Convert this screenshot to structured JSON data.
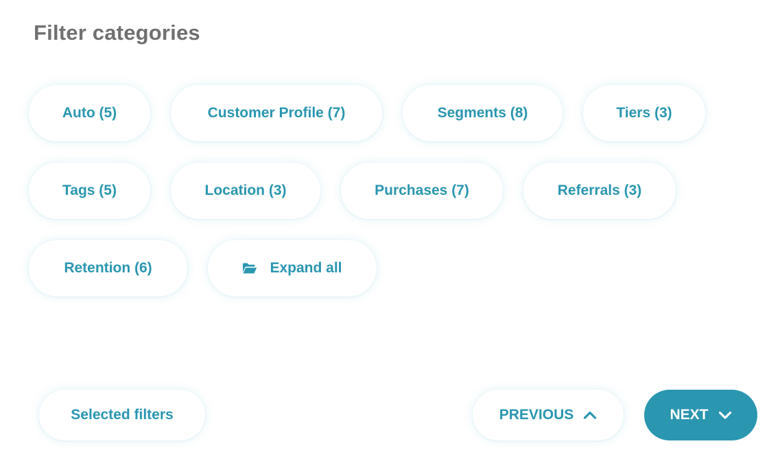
{
  "header": {
    "title": "Filter categories"
  },
  "chips": {
    "auto": "Auto (5)",
    "customer_profile": "Customer Profile (7)",
    "segments": "Segments (8)",
    "tiers": "Tiers (3)",
    "tags": "Tags (5)",
    "location": "Location (3)",
    "purchases": "Purchases (7)",
    "referrals": "Referrals (3)",
    "retention": "Retention (6)",
    "expand_all": "Expand all"
  },
  "footer": {
    "selected_filters": "Selected filters",
    "previous": "PREVIOUS",
    "next": "NEXT"
  },
  "icons": {
    "expand_all": "folder-open-icon",
    "previous": "chevron-up-icon",
    "next": "chevron-down-icon"
  },
  "colors": {
    "accent": "#2a96b0",
    "title": "#707070",
    "background": "#ffffff"
  }
}
